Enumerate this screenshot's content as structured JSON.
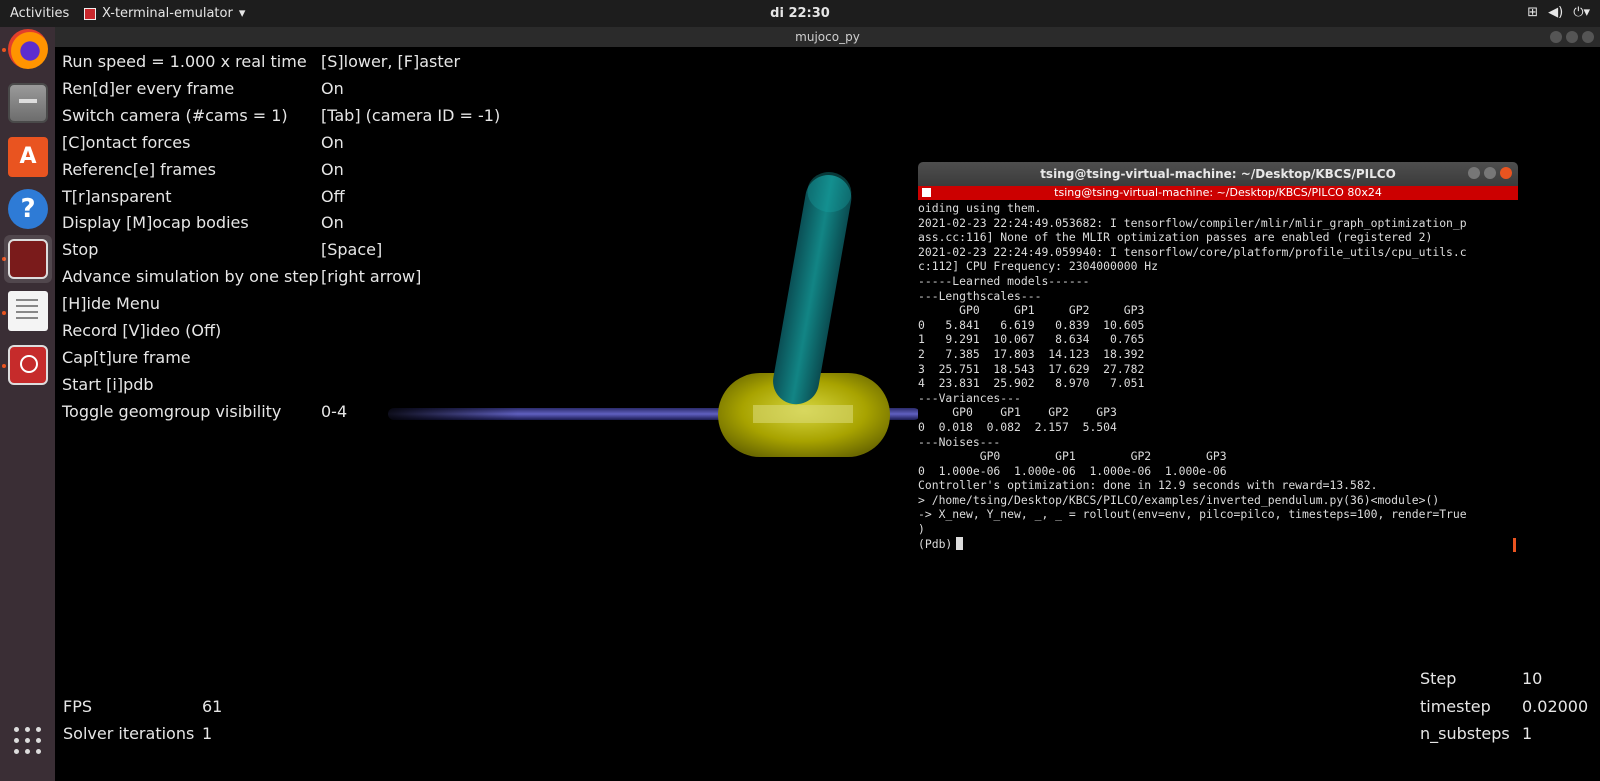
{
  "topbar": {
    "activities": "Activities",
    "app_name": "X-terminal-emulator",
    "clock": "di 22:30",
    "tray_icons": [
      "network-icon",
      "volume-icon",
      "power-icon"
    ]
  },
  "dock": {
    "items": [
      "firefox-icon",
      "files-icon",
      "software-center-icon",
      "help-icon",
      "terminal-icon",
      "text-editor-icon",
      "app-icon"
    ],
    "show_apps": "show-applications-icon"
  },
  "window": {
    "title": "mujoco_py"
  },
  "menu": {
    "rows": [
      {
        "key": "Run speed = 1.000 x real time",
        "value": "[S]lower, [F]aster"
      },
      {
        "key": "Ren[d]er every frame",
        "value": "On"
      },
      {
        "key": "Switch camera (#cams = 1)",
        "value": "[Tab] (camera ID = -1)"
      },
      {
        "key": "[C]ontact forces",
        "value": "On"
      },
      {
        "key": "Referenc[e] frames",
        "value": "On"
      },
      {
        "key": "T[r]ansparent",
        "value": "Off"
      },
      {
        "key": "Display [M]ocap bodies",
        "value": "On"
      },
      {
        "key": "Stop",
        "value": "[Space]"
      },
      {
        "key": "Advance simulation by one step",
        "value": "[right arrow]"
      },
      {
        "key": "[H]ide Menu",
        "value": ""
      },
      {
        "key": "Record [V]ideo (Off)",
        "value": ""
      },
      {
        "key": "Cap[t]ure frame",
        "value": ""
      },
      {
        "key": "Start [i]pdb",
        "value": ""
      },
      {
        "key": "Toggle geomgroup visibility",
        "value": "0-4"
      }
    ]
  },
  "stats_left": {
    "fps_label": "FPS",
    "fps_value": "61",
    "solver_label": "Solver iterations",
    "solver_value": "1"
  },
  "stats_right": {
    "step_label": "Step",
    "step_value": "10",
    "timestep_label": "timestep",
    "timestep_value": "0.02000",
    "nsub_label": "n_substeps",
    "nsub_value": "1"
  },
  "terminal": {
    "title": "tsing@tsing-virtual-machine: ~/Desktop/KBCS/PILCO",
    "tab_title": "tsing@tsing-virtual-machine: ~/Desktop/KBCS/PILCO 80x24",
    "lines": [
      "oiding using them.",
      "2021-02-23 22:24:49.053682: I tensorflow/compiler/mlir/mlir_graph_optimization_p",
      "ass.cc:116] None of the MLIR optimization passes are enabled (registered 2)",
      "2021-02-23 22:24:49.059940: I tensorflow/core/platform/profile_utils/cpu_utils.c",
      "c:112] CPU Frequency: 2304000000 Hz",
      "-----Learned models------",
      "---Lengthscales---",
      "      GP0     GP1     GP2     GP3",
      "0   5.841   6.619   0.839  10.605",
      "1   9.291  10.067   8.634   0.765",
      "2   7.385  17.803  14.123  18.392",
      "3  25.751  18.543  17.629  27.782",
      "4  23.831  25.902   8.970   7.051",
      "---Variances---",
      "     GP0    GP1    GP2    GP3",
      "0  0.018  0.082  2.157  5.504",
      "---Noises---",
      "         GP0        GP1        GP2        GP3",
      "0  1.000e-06  1.000e-06  1.000e-06  1.000e-06",
      "Controller's optimization: done in 12.9 seconds with reward=13.582.",
      "> /home/tsing/Desktop/KBCS/PILCO/examples/inverted_pendulum.py(36)<module>()",
      "-> X_new, Y_new, _, _ = rollout(env=env, pilco=pilco, timesteps=100, render=True",
      ")"
    ],
    "prompt": "(Pdb)"
  },
  "colors": {
    "pole": "#0d6b6b",
    "cart": "#a8a800",
    "rail": "#3a3a8a",
    "terminal_bar": "#cc0000"
  }
}
